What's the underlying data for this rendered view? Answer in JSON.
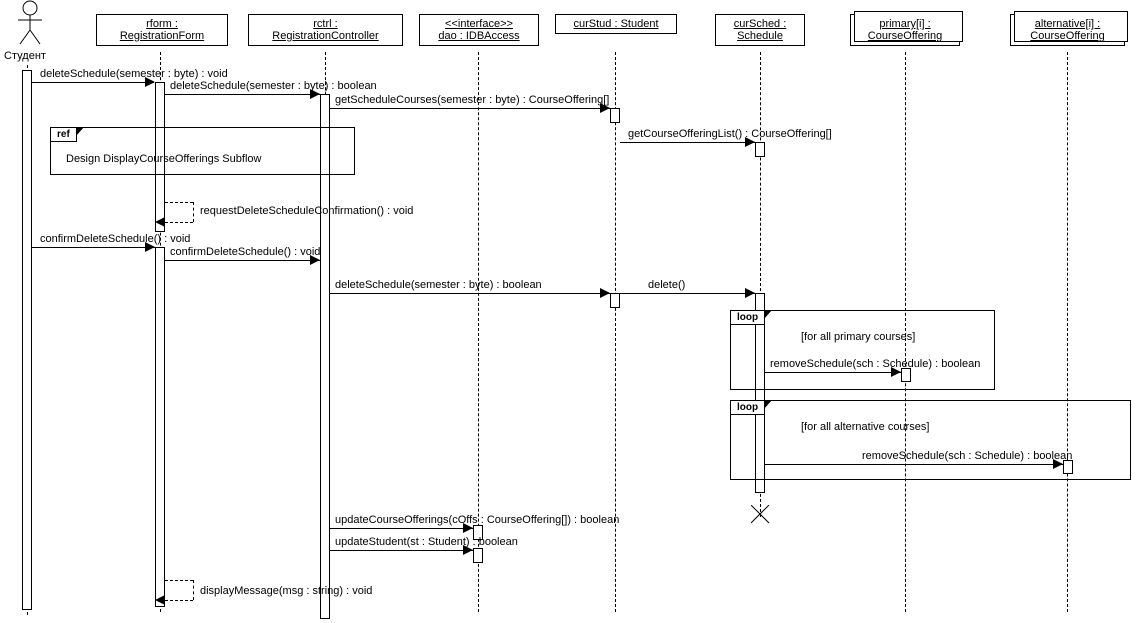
{
  "actor_label": "Студент",
  "lifelines": {
    "rform": "rform :\nRegistrationForm",
    "rctrl": "rctrl :\nRegistrationController",
    "dao": "<<interface>>\ndao : IDBAccess",
    "curStud": "curStud : Student",
    "curSched": "curSched :\nSchedule",
    "primary": "primary[i] :\nCourseOffering",
    "alternative": "alternative[i] :\nCourseOffering"
  },
  "messages": {
    "m1": "deleteSchedule(semester : byte) : void",
    "m2": "deleteSchedule(semester : byte) : boolean",
    "m3": "getScheduleCourses(semester : byte) : CourseOffering[]",
    "m4": "getCourseOfferingList() : CourseOffering[]",
    "m5": "requestDeleteScheduleConfirmation() : void",
    "m6": "confirmDeleteSchedule() : void",
    "m7": "confirmDeleteSchedule() : void",
    "m8": "deleteSchedule(semester : byte) : boolean",
    "m9": "delete()",
    "m10": "removeSchedule(sch : Schedule) : boolean",
    "m11": "removeSchedule(sch : Schedule) : boolean",
    "m12": "updateCourseOfferings(cOffs : CourseOffering[]) : boolean",
    "m13": "updateStudent(st : Student) : boolean",
    "m14": "displayMessage(msg : string) : void"
  },
  "frames": {
    "ref": "ref",
    "refText": "Design DisplayCourseOfferings Subflow",
    "loop1": "loop",
    "loop1Guard": "[for all primary courses]",
    "loop2": "loop",
    "loop2Guard": "[for all alternative courses]"
  },
  "chart_data": {
    "type": "sequence_diagram",
    "actor": "Студент",
    "lifelines": [
      {
        "name": "rform",
        "type": "RegistrationForm"
      },
      {
        "name": "rctrl",
        "type": "RegistrationController"
      },
      {
        "name": "dao",
        "type": "IDBAccess",
        "stereotype": "interface"
      },
      {
        "name": "curStud",
        "type": "Student"
      },
      {
        "name": "curSched",
        "type": "Schedule"
      },
      {
        "name": "primary[i]",
        "type": "CourseOffering",
        "multi": true
      },
      {
        "name": "alternative[i]",
        "type": "CourseOffering",
        "multi": true
      }
    ],
    "interactions": [
      {
        "from": "Студент",
        "to": "rform",
        "msg": "deleteSchedule(semester : byte) : void"
      },
      {
        "from": "rform",
        "to": "rctrl",
        "msg": "deleteSchedule(semester : byte) : boolean"
      },
      {
        "from": "rctrl",
        "to": "curStud",
        "msg": "getScheduleCourses(semester : byte) : CourseOffering[]"
      },
      {
        "from": "curStud",
        "to": "curSched",
        "msg": "getCourseOfferingList() : CourseOffering[]"
      },
      {
        "type": "ref",
        "text": "Design DisplayCourseOfferings Subflow",
        "covers": [
          "rform",
          "rctrl"
        ]
      },
      {
        "from": "rform",
        "to": "rform",
        "msg": "requestDeleteScheduleConfirmation() : void",
        "self": true,
        "return": true
      },
      {
        "from": "Студент",
        "to": "rform",
        "msg": "confirmDeleteSchedule() : void"
      },
      {
        "from": "rform",
        "to": "rctrl",
        "msg": "confirmDeleteSchedule() : void"
      },
      {
        "from": "rctrl",
        "to": "curStud",
        "msg": "deleteSchedule(semester : byte) : boolean"
      },
      {
        "from": "curStud",
        "to": "curSched",
        "msg": "delete()"
      },
      {
        "type": "loop",
        "guard": "[for all primary courses]",
        "messages": [
          {
            "from": "curSched",
            "to": "primary[i]",
            "msg": "removeSchedule(sch : Schedule) : boolean"
          }
        ]
      },
      {
        "type": "loop",
        "guard": "[for all alternative courses]",
        "messages": [
          {
            "from": "curSched",
            "to": "alternative[i]",
            "msg": "removeSchedule(sch : Schedule) : boolean"
          }
        ]
      },
      {
        "type": "destroy",
        "target": "curSched"
      },
      {
        "from": "rctrl",
        "to": "dao",
        "msg": "updateCourseOfferings(cOffs : CourseOffering[]) : boolean"
      },
      {
        "from": "rctrl",
        "to": "dao",
        "msg": "updateStudent(st : Student) : boolean"
      },
      {
        "from": "rform",
        "to": "rform",
        "msg": "displayMessage(msg : string) : void",
        "self": true,
        "return": true
      }
    ]
  }
}
